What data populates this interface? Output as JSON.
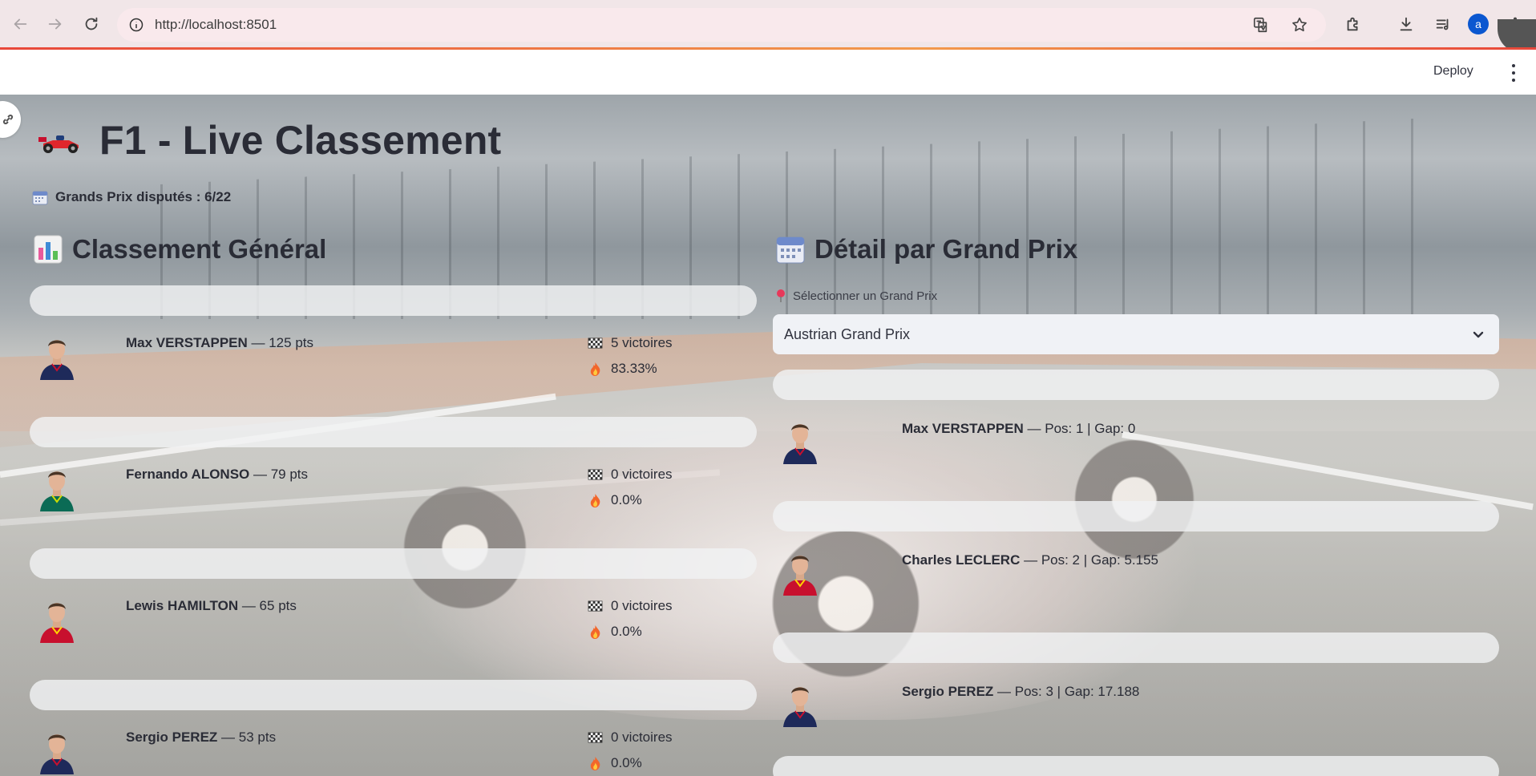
{
  "browser": {
    "url": "http://localhost:8501",
    "profile_initial": "a"
  },
  "header": {
    "deploy_label": "Deploy"
  },
  "app": {
    "title": "F1 - Live Classement",
    "gp_count": "Grands Prix disputés : 6/22",
    "general_section_title": "Classement Général",
    "detail_section_title": "Détail par Grand Prix",
    "select_label": "Sélectionner un Grand Prix",
    "select_value": "Austrian Grand Prix"
  },
  "standings": [
    {
      "name": "Max VERSTAPPEN",
      "points": " — 125 pts",
      "wins": "5 victoires",
      "rate": "83.33%",
      "team_color": "#1e2a5a",
      "accent": "#c8102e"
    },
    {
      "name": "Fernando ALONSO",
      "points": " — 79 pts",
      "wins": "0 victoires",
      "rate": "0.0%",
      "team_color": "#0b6b55",
      "accent": "#cedc00"
    },
    {
      "name": "Lewis HAMILTON",
      "points": " — 65 pts",
      "wins": "0 victoires",
      "rate": "0.0%",
      "team_color": "#c8102e",
      "accent": "#ffd400"
    },
    {
      "name": "Sergio PEREZ",
      "points": " — 53 pts",
      "wins": "0 victoires",
      "rate": "0.0%",
      "team_color": "#1e2a5a",
      "accent": "#c8102e"
    }
  ],
  "gp_results": [
    {
      "name": "Max VERSTAPPEN",
      "detail": " — Pos: 1 | Gap: 0",
      "team_color": "#1e2a5a",
      "accent": "#c8102e"
    },
    {
      "name": "Charles LECLERC",
      "detail": " — Pos: 2 | Gap: 5.155",
      "team_color": "#c8102e",
      "accent": "#ffd400"
    },
    {
      "name": "Sergio PEREZ",
      "detail": " — Pos: 3 | Gap: 17.188",
      "team_color": "#1e2a5a",
      "accent": "#c8102e"
    }
  ],
  "icons": {
    "title": "racing-car-icon",
    "calendar": "calendar-icon",
    "chart": "bar-chart-icon",
    "wins": "chequered-flag-icon",
    "rate": "fire-icon",
    "select": "round-pushpin-icon"
  }
}
